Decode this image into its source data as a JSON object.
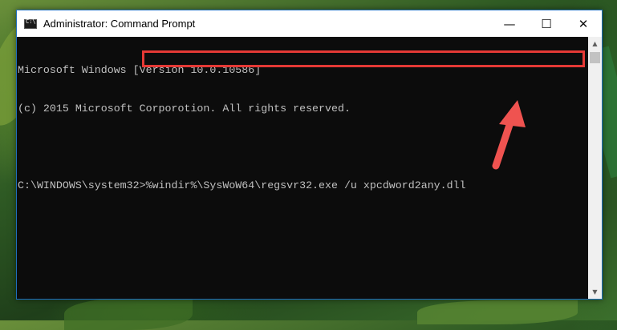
{
  "window": {
    "title": "Administrator: Command Prompt",
    "controls": {
      "minimize": "—",
      "maximize": "☐",
      "close": "✕"
    }
  },
  "console": {
    "lines": [
      "Microsoft Windows [Version 10.0.10586]",
      "(c) 2015 Microsoft Corporotion. All rights reserved.",
      ""
    ],
    "prompt": "C:\\WINDOWS\\system32>",
    "command": "%windir%\\SysWoW64\\regsvr32.exe /u xpcdword2any.dll"
  },
  "scrollbar": {
    "up": "▲",
    "down": "▼"
  },
  "colors": {
    "highlight": "#e53935",
    "arrow": "#ef5350",
    "console_bg": "#0c0c0c",
    "console_text": "#c0c0c0"
  },
  "icons": {
    "app": "cmd-icon",
    "arrow": "arrow-annotation-icon"
  }
}
